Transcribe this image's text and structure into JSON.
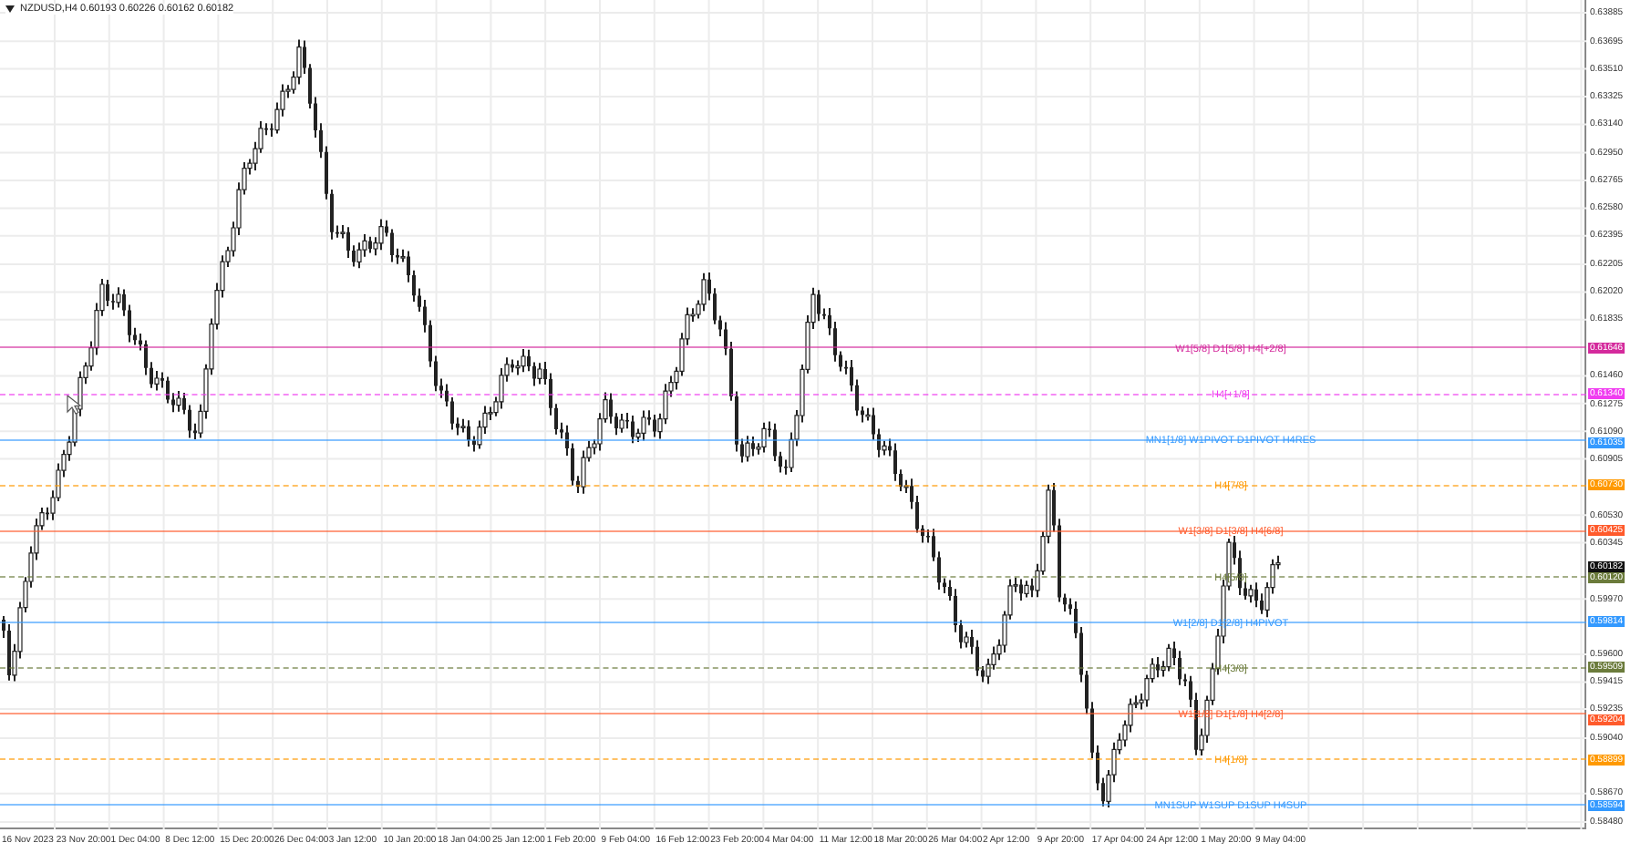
{
  "title": "NZDUSD,H4  0.60193 0.60226 0.60162 0.60182",
  "y_ticks": [
    "0.63885",
    "0.63695",
    "0.63510",
    "0.63325",
    "0.63140",
    "0.62950",
    "0.62765",
    "0.62580",
    "0.62395",
    "0.62205",
    "0.62020",
    "0.61835",
    "0.61460",
    "0.61275",
    "0.61090",
    "0.60905",
    "0.60530",
    "0.60345",
    "0.59970",
    "0.59600",
    "0.59415",
    "0.59235",
    "0.59040",
    "0.58670",
    "0.58480"
  ],
  "x_ticks": [
    "16 Nov 2023",
    "23 Nov 20:00",
    "1 Dec 04:00",
    "8 Dec 12:00",
    "15 Dec 20:00",
    "26 Dec 04:00",
    "3 Jan 12:00",
    "10 Jan 20:00",
    "18 Jan 04:00",
    "25 Jan 12:00",
    "1 Feb 20:00",
    "9 Feb 04:00",
    "16 Feb 12:00",
    "23 Feb 20:00",
    "4 Mar 04:00",
    "11 Mar 12:00",
    "18 Mar 20:00",
    "26 Mar 04:00",
    "2 Apr 12:00",
    "9 Apr 20:00",
    "17 Apr 04:00",
    "24 Apr 12:00",
    "1 May 20:00",
    "9 May 04:00"
  ],
  "current_price": "0.60182",
  "levels": [
    {
      "label": "W1[5/8] D1[5/8] H4[+2/8]",
      "price": "0.61646",
      "color": "#d42a9c",
      "dashed": false
    },
    {
      "label": "H4[+1/8]",
      "price": "0.61340",
      "color": "#f03cf0",
      "dashed": true
    },
    {
      "label": "MN1[1/8] W1PIVOT D1PIVOT H4RES",
      "price": "0.61035",
      "color": "#3399ff",
      "dashed": false
    },
    {
      "label": "H4[7/8]",
      "price": "0.60730",
      "color": "#ff9900",
      "dashed": true
    },
    {
      "label": "W1[3/8] D1[3/8] H4[6/8]",
      "price": "0.60425",
      "color": "#ff5a2b",
      "dashed": false
    },
    {
      "label": "H4[5/8]",
      "price": "0.60120",
      "color": "#6b7b3b",
      "dashed": true
    },
    {
      "label": "W1[2/8] D1[2/8] H4PIVOT",
      "price": "0.59814",
      "color": "#3399ff",
      "dashed": false
    },
    {
      "label": "H4[3/8]",
      "price": "0.59509",
      "color": "#6b7b3b",
      "dashed": true
    },
    {
      "label": "W1[1/8] D1[1/8] H4[2/8]",
      "price": "0.59204",
      "color": "#ff5a2b",
      "dashed": false
    },
    {
      "label": "H4[1/8]",
      "price": "0.58899",
      "color": "#ff9900",
      "dashed": true
    },
    {
      "label": "MN1SUP W1SUP D1SUP H4SUP",
      "price": "0.58594",
      "color": "#3399ff",
      "dashed": false
    }
  ]
}
